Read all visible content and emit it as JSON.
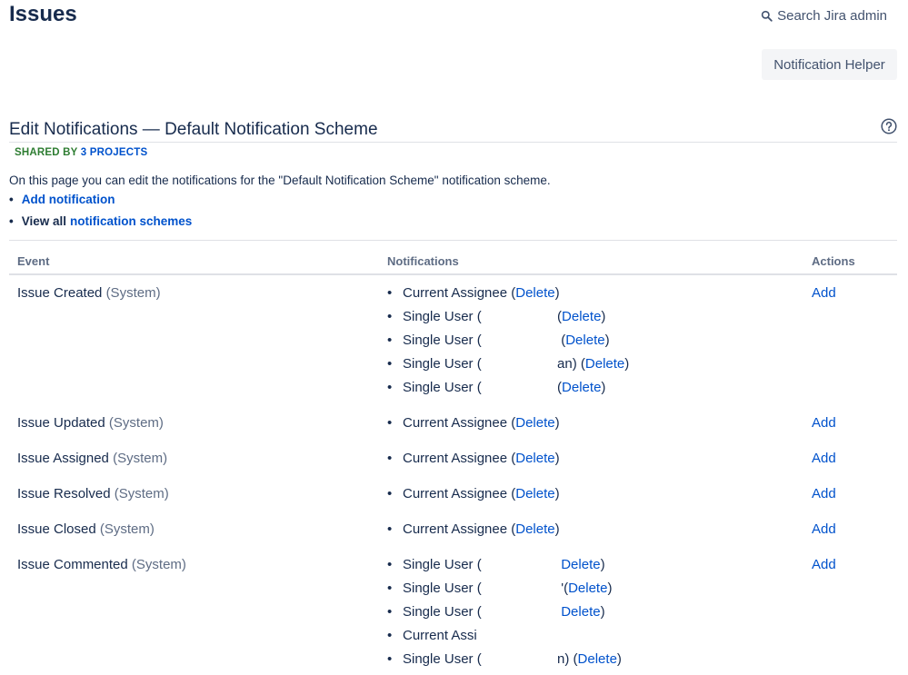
{
  "header": {
    "title": "Issues",
    "search_label": "Search Jira admin",
    "helper_label": "Notification Helper"
  },
  "scheme": {
    "title": "Edit Notifications — Default Notification Scheme",
    "shared_label": "SHARED BY",
    "shared_link": "3 PROJECTS",
    "description": "On this page you can edit the notifications for the \"Default Notification Scheme\" notification scheme.",
    "add_link": "Add notification",
    "view_prefix": "View all",
    "view_link": "notification schemes"
  },
  "table": {
    "headers": {
      "event": "Event",
      "notifications": "Notifications",
      "actions": "Actions"
    },
    "rows": [
      {
        "event": "Issue Created",
        "suffix": "(System)",
        "action": "Add",
        "notifications": [
          {
            "text": "Current Assignee (",
            "link": "Delete",
            "after": ")"
          },
          {
            "text": "Single User (                    (",
            "link": "Delete",
            "after": ")"
          },
          {
            "text": "Single User (                     (",
            "link": "Delete",
            "after": ")"
          },
          {
            "text": "Single User (                    an) (",
            "link": "Delete",
            "after": ")"
          },
          {
            "text": "Single User (                    (",
            "link": "Delete",
            "after": ")"
          }
        ]
      },
      {
        "event": "Issue Updated",
        "suffix": "(System)",
        "action": "Add",
        "notifications": [
          {
            "text": "Current Assignee (",
            "link": "Delete",
            "after": ")"
          }
        ]
      },
      {
        "event": "Issue Assigned",
        "suffix": "(System)",
        "action": "Add",
        "notifications": [
          {
            "text": "Current Assignee (",
            "link": "Delete",
            "after": ")"
          }
        ]
      },
      {
        "event": "Issue Resolved",
        "suffix": "(System)",
        "action": "Add",
        "notifications": [
          {
            "text": "Current Assignee (",
            "link": "Delete",
            "after": ")"
          }
        ]
      },
      {
        "event": "Issue Closed",
        "suffix": "(System)",
        "action": "Add",
        "notifications": [
          {
            "text": "Current Assignee (",
            "link": "Delete",
            "after": ")"
          }
        ]
      },
      {
        "event": "Issue Commented",
        "suffix": "(System)",
        "action": "Add",
        "notifications": [
          {
            "text": "Single User (                     ",
            "link": "Delete",
            "after": ")"
          },
          {
            "text": "Single User (                     '(",
            "link": "Delete",
            "after": ")"
          },
          {
            "text": "Single User (                     ",
            "link": "Delete",
            "after": ")"
          },
          {
            "text": "Current Assi",
            "link": "",
            "after": ""
          },
          {
            "text": "Single User (                    n) (",
            "link": "Delete",
            "after": ")"
          }
        ]
      }
    ]
  }
}
